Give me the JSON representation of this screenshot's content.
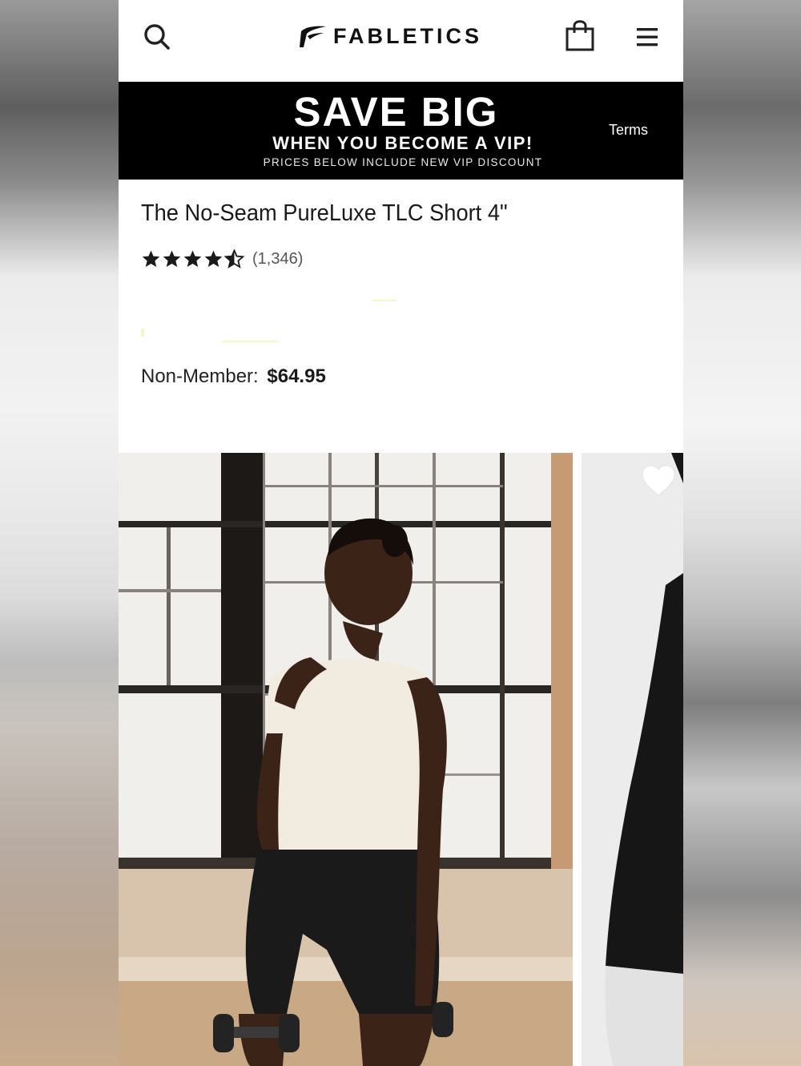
{
  "header": {
    "brand": "FABLETICS",
    "icons": [
      "search-icon",
      "shopping-bag-icon",
      "hamburger-menu-icon"
    ]
  },
  "promo": {
    "headline": "SAVE BIG",
    "subheadline": "WHEN YOU BECOME A VIP!",
    "fine_print": "PRICES BELOW INCLUDE NEW VIP DISCOUNT",
    "terms_label": "Terms"
  },
  "product": {
    "title": "The No-Seam PureLuxe TLC Short 4\"",
    "rating": 4.5,
    "review_count": "(1,346)",
    "non_member_label": "Non-Member:",
    "non_member_price": "$64.95"
  },
  "gallery": {
    "favorite_icon": "heart-icon"
  },
  "colors": {
    "banner_bg": "#000000",
    "text_primary": "#1a1a1a",
    "page_bg": "#ffffff"
  }
}
